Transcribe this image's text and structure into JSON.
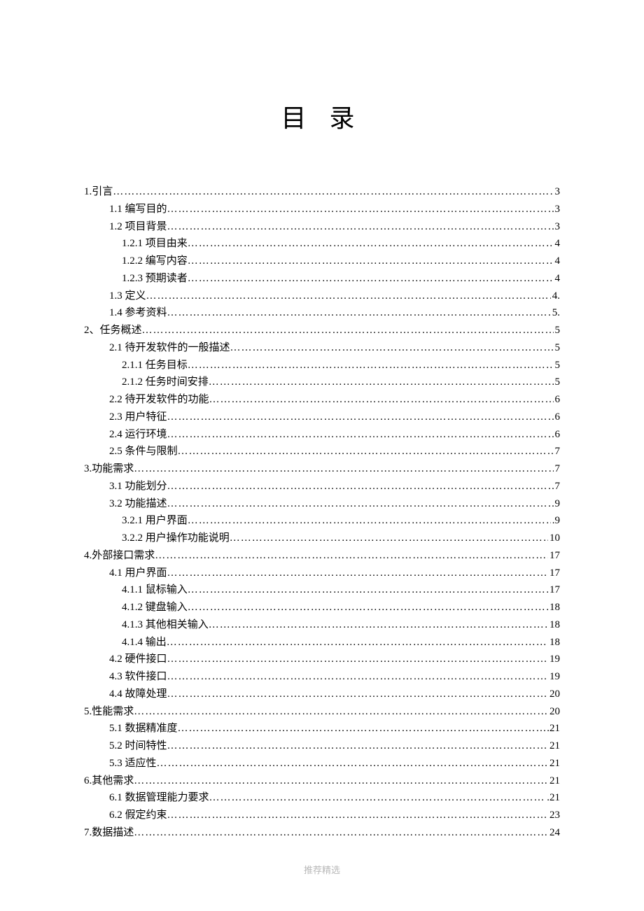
{
  "title": "目 录",
  "footer": "推荐精选",
  "toc": [
    {
      "indent": 0,
      "label": "1.引言",
      "page": "3"
    },
    {
      "indent": 1,
      "label": "1.1 编写目的",
      "page": "3"
    },
    {
      "indent": 1,
      "label": "1.2 项目背景",
      "page": "3"
    },
    {
      "indent": 2,
      "label": "1.2.1 项目由来",
      "page": "4"
    },
    {
      "indent": 2,
      "label": "1.2.2 编写内容",
      "page": "4"
    },
    {
      "indent": 2,
      "label": "1.2.3 预期读者",
      "page": "4"
    },
    {
      "indent": 1,
      "label": "1.3 定义",
      "page": "4."
    },
    {
      "indent": 1,
      "label": "1.4 参考资料",
      "page": "5."
    },
    {
      "indent": 0,
      "label": "2、任务概述",
      "page": "5"
    },
    {
      "indent": 1,
      "label": "2.1 待开发软件的一般描述",
      "page": "5"
    },
    {
      "indent": 2,
      "label": "2.1.1 任务目标",
      "page": "5"
    },
    {
      "indent": 2,
      "label": "2.1.2 任务时间安排",
      "page": "5"
    },
    {
      "indent": 1,
      "label": "2.2 待开发软件的功能",
      "page": "6"
    },
    {
      "indent": 1,
      "label": "2.3 用户特征",
      "page": "6"
    },
    {
      "indent": 1,
      "label": "2.4 运行环境",
      "page": "6"
    },
    {
      "indent": 1,
      "label": "2.5 条件与限制",
      "page": "7"
    },
    {
      "indent": 0,
      "label": "3.功能需求",
      "page": "7"
    },
    {
      "indent": 1,
      "label": "3.1 功能划分",
      "page": "7"
    },
    {
      "indent": 1,
      "label": "3.2 功能描述",
      "page": "9"
    },
    {
      "indent": 2,
      "label": "3.2.1 用户界面",
      "page": ".9"
    },
    {
      "indent": 2,
      "label": "3.2.2 用户操作功能说明",
      "page": "10"
    },
    {
      "indent": 0,
      "label": "4.外部接口需求",
      "page": "17"
    },
    {
      "indent": 1,
      "label": "4.1 用户界面",
      "page": "17"
    },
    {
      "indent": 2,
      "label": "4.1.1 鼠标输入",
      "page": "17"
    },
    {
      "indent": 2,
      "label": "4.1.2 键盘输入",
      "page": "18"
    },
    {
      "indent": 2,
      "label": "4.1.3 其他相关输入",
      "page": "18"
    },
    {
      "indent": 2,
      "label": "4.1.4 输出",
      "page": "18"
    },
    {
      "indent": 1,
      "label": "4.2 硬件接口",
      "page": "19"
    },
    {
      "indent": 1,
      "label": "4.3 软件接口",
      "page": "19"
    },
    {
      "indent": 1,
      "label": "4.4 故障处理",
      "page": "20"
    },
    {
      "indent": 0,
      "label": "5.性能需求",
      "page": "20"
    },
    {
      "indent": 1,
      "label": "5.1 数据精准度",
      "page": ".21"
    },
    {
      "indent": 1,
      "label": "5.2 时间特性",
      "page": "21"
    },
    {
      "indent": 1,
      "label": "5.3 适应性",
      "page": "21"
    },
    {
      "indent": 0,
      "label": "6.其他需求",
      "page": "21"
    },
    {
      "indent": 1,
      "label": "6.1 数据管理能力要求",
      "page": ".21"
    },
    {
      "indent": 1,
      "label": "6.2 假定约束",
      "page": "23"
    },
    {
      "indent": 0,
      "label": "7.数据描述",
      "page": "24"
    }
  ]
}
